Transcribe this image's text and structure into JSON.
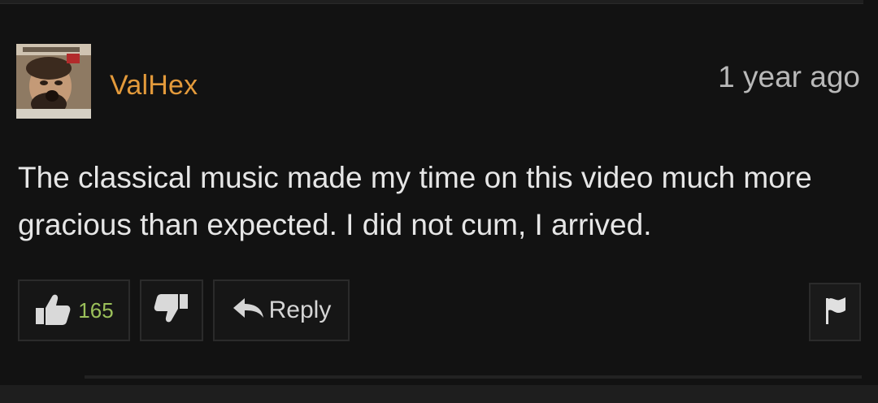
{
  "comment": {
    "username": "ValHex",
    "timestamp": "1 year ago",
    "text": "The classical music made my time on this video much more gracious than expected. I did not cum, I arrived."
  },
  "actions": {
    "like_count": "165",
    "reply_label": "Reply"
  },
  "colors": {
    "username": "#e39a3b",
    "like_count": "#9bc05a",
    "background": "#121212",
    "text": "#e6e6e6"
  },
  "icons": {
    "like": "thumbs-up-icon",
    "dislike": "thumbs-down-icon",
    "reply": "reply-arrow-icon",
    "flag": "flag-icon"
  }
}
